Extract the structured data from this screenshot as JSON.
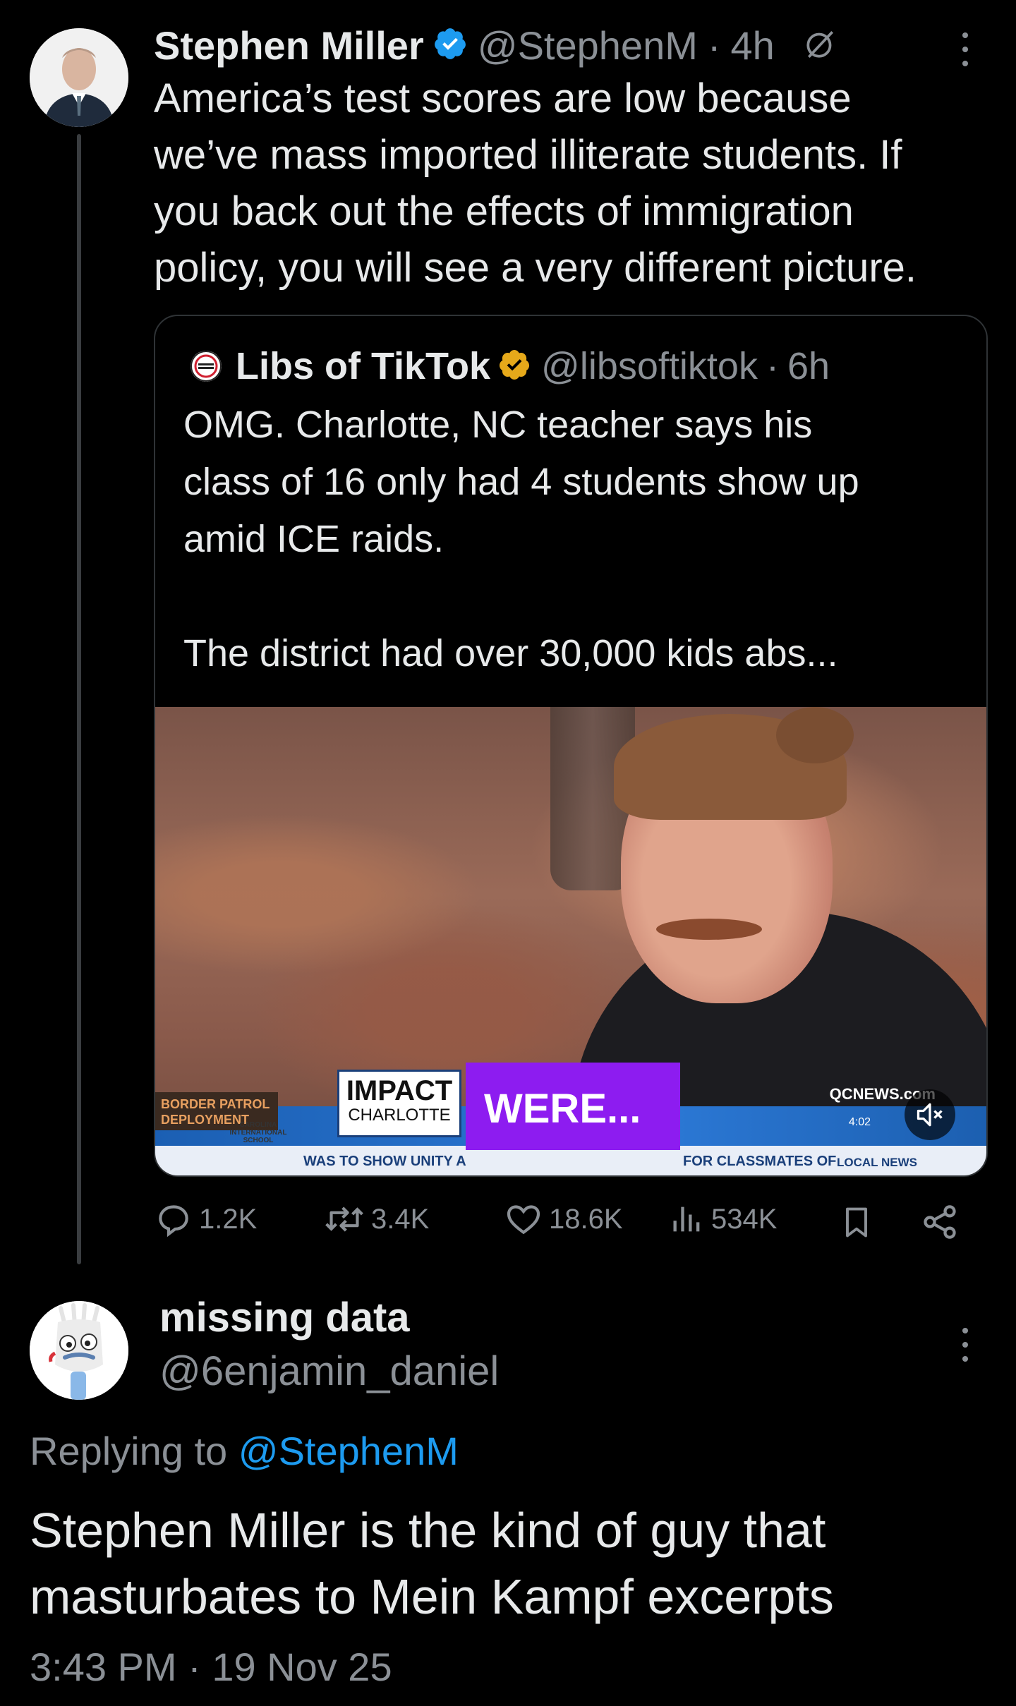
{
  "tweet": {
    "author_name": "Stephen Miller",
    "handle": "@StephenM",
    "time": "4h",
    "separator": "·",
    "text_lines": [
      "America’s test scores are low because",
      "we’ve mass imported illiterate students. If",
      "you back out the effects of immigration",
      "policy, you will see a very different picture."
    ],
    "verified_color": "#1d9bf0",
    "quote": {
      "author_name": "Libs of TikTok",
      "handle": "@libsoftiktok",
      "time": "6h",
      "separator": "·",
      "verified_color": "#e6a91a",
      "text": "OMG. Charlotte, NC teacher says his\nclass of 16 only had 4 students show up\namid ICE raids.\n\nThe district had over 30,000 kids abs...",
      "video": {
        "caption_word": "WERE...",
        "impact_line1": "IMPACT",
        "impact_line2": "CHARLOTTE",
        "patrol_text": "BORDER PATROL DEPLOYMENT",
        "ticker_left": "WAS TO SHOW UNITY A",
        "ticker_right": "FOR CLASSMATES OF",
        "local_news": "LOCAL NEWS",
        "station": "QCNEWS.com",
        "clock": "4:02",
        "school_label": "CAROLINA INTERNATIONAL SCHOOL"
      }
    },
    "stats": {
      "replies": "1.2K",
      "reposts": "3.4K",
      "likes": "18.6K",
      "views": "534K"
    }
  },
  "reply": {
    "author_name": "missing data",
    "handle": "@6enjamin_daniel",
    "replying_prefix": "Replying to",
    "replying_to": "@StephenM",
    "text_lines": [
      "Stephen Miller is the kind of guy that",
      "masturbates to Mein Kampf excerpts"
    ],
    "timestamp": "3:43 PM · 19 Nov 25"
  }
}
